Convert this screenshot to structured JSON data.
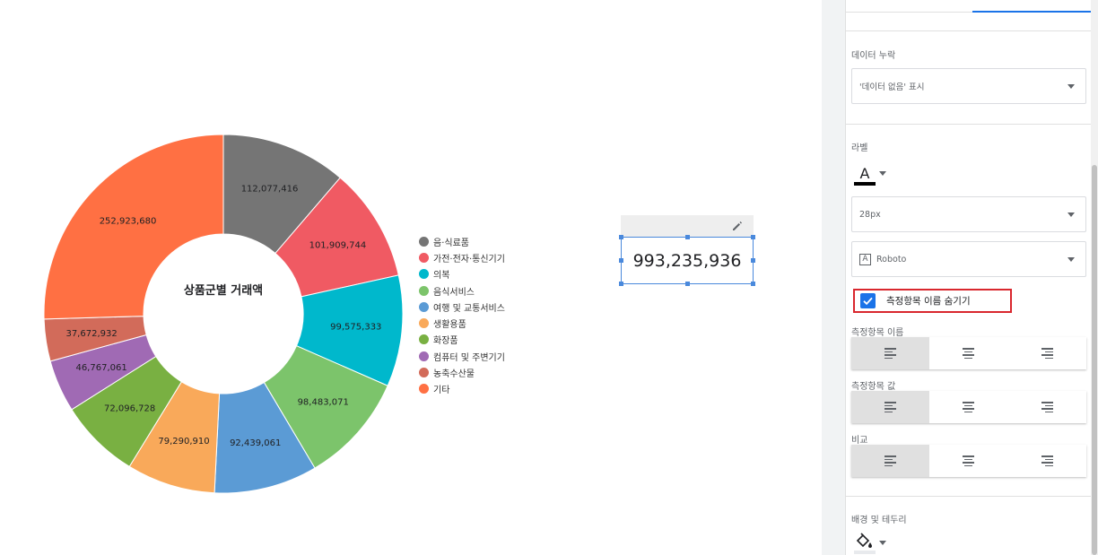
{
  "chart": {
    "center_title": "상품군별 거래액",
    "slices": [
      {
        "name": "음·식료품",
        "value": 112077416,
        "label": "112,077,416",
        "color": "#757575"
      },
      {
        "name": "가전·전자·통신기기",
        "value": 101909744,
        "label": "101,909,744",
        "color": "#f05a63"
      },
      {
        "name": "의복",
        "value": 99575333,
        "label": "99,575,333",
        "color": "#00b8cc"
      },
      {
        "name": "음식서비스",
        "value": 98483071,
        "label": "98,483,071",
        "color": "#7cc46b"
      },
      {
        "name": "여행 및 교통서비스",
        "value": 92439061,
        "label": "92,439,061",
        "color": "#5b9bd5"
      },
      {
        "name": "생활용품",
        "value": 79290910,
        "label": "79,290,910",
        "color": "#f9a95a"
      },
      {
        "name": "화장품",
        "value": 72096728,
        "label": "72,096,728",
        "color": "#79b042"
      },
      {
        "name": "컴퓨터 및 주변기기",
        "value": 46767061,
        "label": "46,767,061",
        "color": "#a06ab4"
      },
      {
        "name": "농축수산물",
        "value": 37672932,
        "label": "37,672,932",
        "color": "#d26b5a"
      },
      {
        "name": "기타",
        "value": 252923680,
        "label": "252,923,680",
        "color": "#ff7043"
      }
    ]
  },
  "scorecard": {
    "value": "993,235,936"
  },
  "panel": {
    "missing_data_label": "데이터 누락",
    "missing_data_value": "'데이터 없음' 표시",
    "label_section": "라벨",
    "font_color_letter": "A",
    "font_size_value": "28px",
    "font_family_value": "Roboto",
    "font_family_icon": "A",
    "hide_metric_name_label": "측정항목 이름 숨기기",
    "metric_name_label": "측정항목 이름",
    "metric_value_label": "측정항목 값",
    "comparison_label": "비교",
    "background_border_label": "배경 및 테두리"
  }
}
